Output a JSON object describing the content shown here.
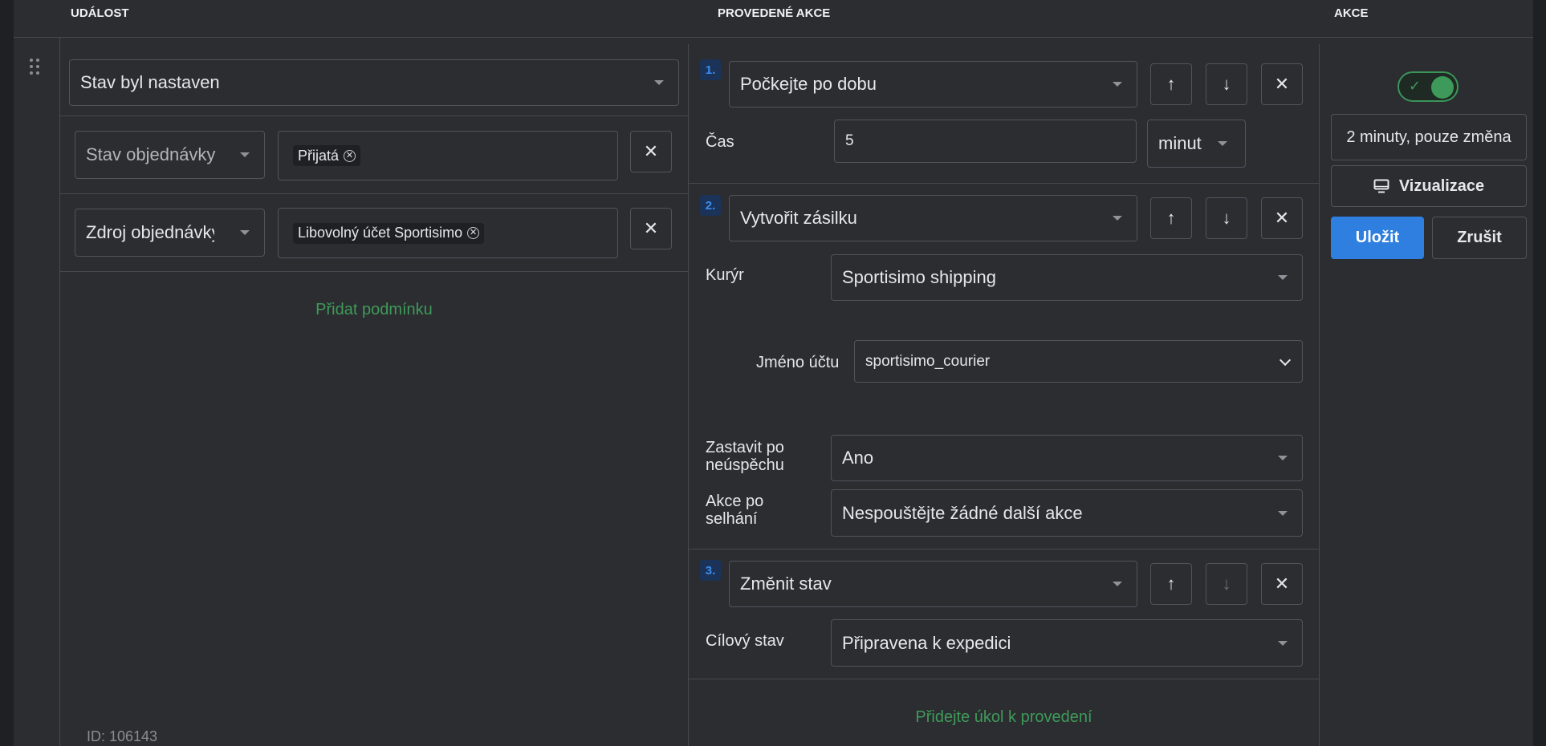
{
  "header": {
    "event": "UDÁLOST",
    "actions_performed": "PROVEDENÉ AKCE",
    "actions": "AKCE"
  },
  "event": {
    "trigger": "Stav byl nastaven",
    "conditions": [
      {
        "field": "Stav objednávky",
        "tag": "Přijatá"
      },
      {
        "field": "Zdroj objednávky",
        "tag": "Libovolný účet Sportisimo"
      }
    ],
    "add_condition": "Přidat podmínku",
    "id_label": "ID: 106143"
  },
  "steps": {
    "s1": {
      "number": "1.",
      "action": "Počkejte po dobu",
      "time_label": "Čas",
      "time_value": "5",
      "time_unit": "minut"
    },
    "s2": {
      "number": "2.",
      "action": "Vytvořit zásilku",
      "courier_label": "Kurýr",
      "courier_value": "Sportisimo shipping",
      "account_label": "Jméno účtu",
      "account_value": "sportisimo_courier",
      "stop_label_1": "Zastavit po",
      "stop_label_2": "neúspěchu",
      "stop_value": "Ano",
      "fail_label_1": "Akce po",
      "fail_label_2": "selhání",
      "fail_value": "Nespouštějte žádné další akce"
    },
    "s3": {
      "number": "3.",
      "action": "Změnit stav",
      "target_label": "Cílový stav",
      "target_value": "Připravena k expedici"
    },
    "add_task": "Přidejte úkol k provedení"
  },
  "buttons": {
    "up": "↑",
    "down": "↓",
    "close": "✕"
  },
  "side": {
    "toggle_on": true,
    "schedule": "2 minuty, pouze změna",
    "visualize": "Vizualizace",
    "save": "Uložit",
    "cancel": "Zrušit"
  },
  "colors": {
    "accent_blue": "#2f7fe0",
    "success_green": "#3d9a5a",
    "background": "#2b2d31"
  }
}
